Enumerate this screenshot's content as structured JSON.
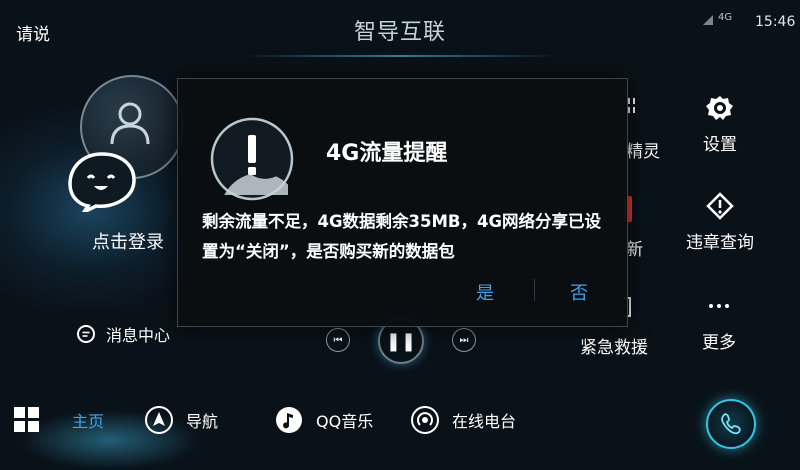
{
  "status_bar": {
    "voice_label": "请说",
    "title": "智导互联",
    "network": "4G",
    "time": "15:46"
  },
  "user": {
    "login_label": "点击登录",
    "message_center_label": "消息中心"
  },
  "tiles": {
    "partial_top": "精灵",
    "settings": "设置",
    "partial_middle": "新",
    "violation_query": "违章查询",
    "emergency_rescue": "紧急救援",
    "more": "更多"
  },
  "bottom_nav": {
    "home": "主页",
    "navigation": "导航",
    "qq_music": "QQ音乐",
    "online_radio": "在线电台"
  },
  "dialog": {
    "title": "4G流量提醒",
    "message": "剩余流量不足，4G数据剩余35MB，4G网络分享已设置为“关闭”，是否购买新的数据包",
    "yes_label": "是",
    "no_label": "否"
  },
  "colors": {
    "accent": "#3ea3ec",
    "voice_ring": "#33c6e6",
    "dialog_bg": "#0a0e12",
    "background": "#0a1219"
  },
  "icons": {
    "voice_assistant": "voice-assistant-icon",
    "warning": "exclamation-icon"
  }
}
